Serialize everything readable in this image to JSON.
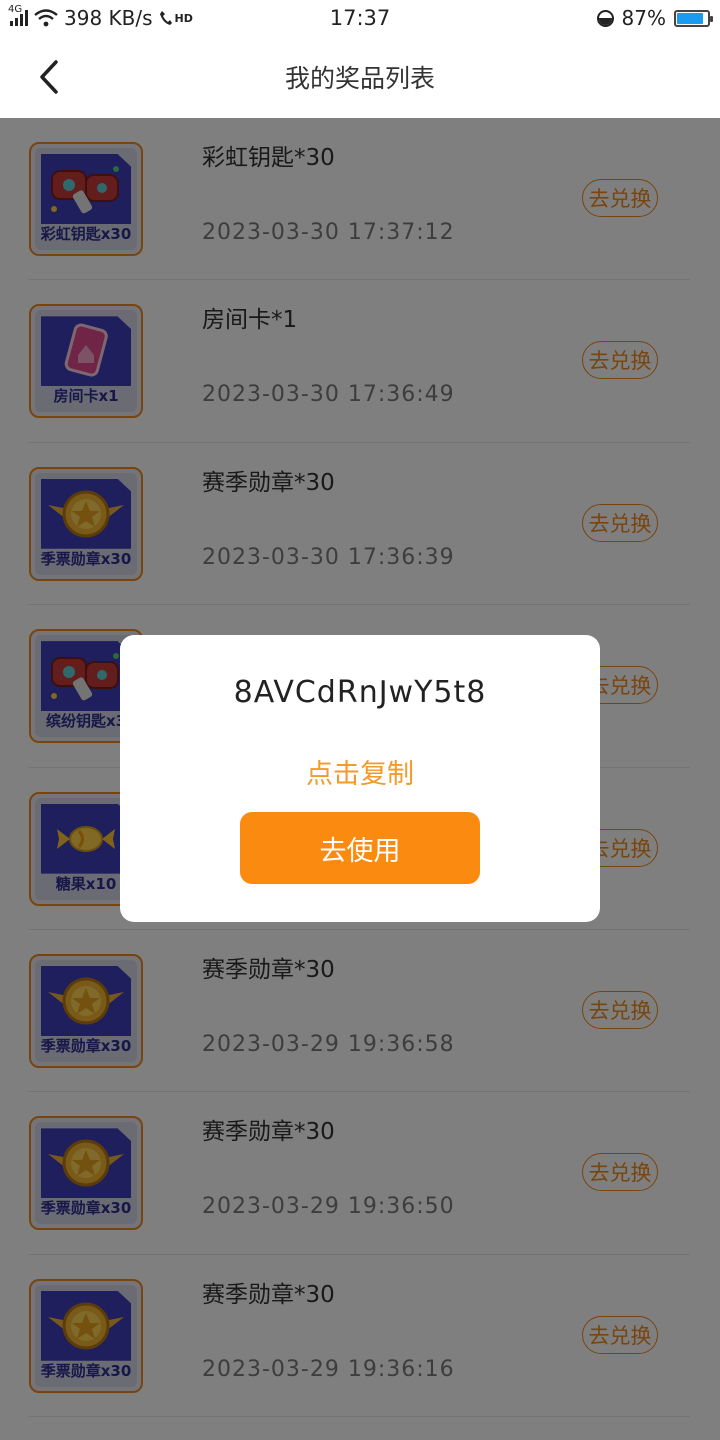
{
  "status_bar": {
    "network": "4G",
    "speed": "398 KB/s",
    "hd": "HD",
    "time": "17:37",
    "battery": "87%",
    "battery_level": 0.87
  },
  "nav": {
    "title": "我的奖品列表"
  },
  "prizes": [
    {
      "name": "彩虹钥匙*30",
      "time": "2023-03-30 17:37:12",
      "thumb_label": "彩虹钥匙x30",
      "icon": "key-icon",
      "action": "去兑换"
    },
    {
      "name": "房间卡*1",
      "time": "2023-03-30 17:36:49",
      "thumb_label": "房间卡x1",
      "icon": "room-card-icon",
      "action": "去兑换"
    },
    {
      "name": "赛季勋章*30",
      "time": "2023-03-30 17:36:39",
      "thumb_label": "季票勋章x30",
      "icon": "medal-icon",
      "action": "去兑换"
    },
    {
      "name": "",
      "time": "",
      "thumb_label": "缤纷钥匙x3",
      "icon": "key-icon",
      "action": "去兑换"
    },
    {
      "name": "",
      "time": "",
      "thumb_label": "糖果x10",
      "icon": "candy-icon",
      "action": "去兑换"
    },
    {
      "name": "赛季勋章*30",
      "time": "2023-03-29 19:36:58",
      "thumb_label": "季票勋章x30",
      "icon": "medal-icon",
      "action": "去兑换"
    },
    {
      "name": "赛季勋章*30",
      "time": "2023-03-29 19:36:50",
      "thumb_label": "季票勋章x30",
      "icon": "medal-icon",
      "action": "去兑换"
    },
    {
      "name": "赛季勋章*30",
      "time": "2023-03-29 19:36:16",
      "thumb_label": "季票勋章x30",
      "icon": "medal-icon",
      "action": "去兑换"
    }
  ],
  "dialog": {
    "code": "8AVCdRnJwY5t8",
    "copy_label": "点击复制",
    "use_label": "去使用"
  },
  "colors": {
    "accent": "#fb8a10",
    "outline": "#f08a1d",
    "thumb_bg": "#3d3fb8"
  }
}
